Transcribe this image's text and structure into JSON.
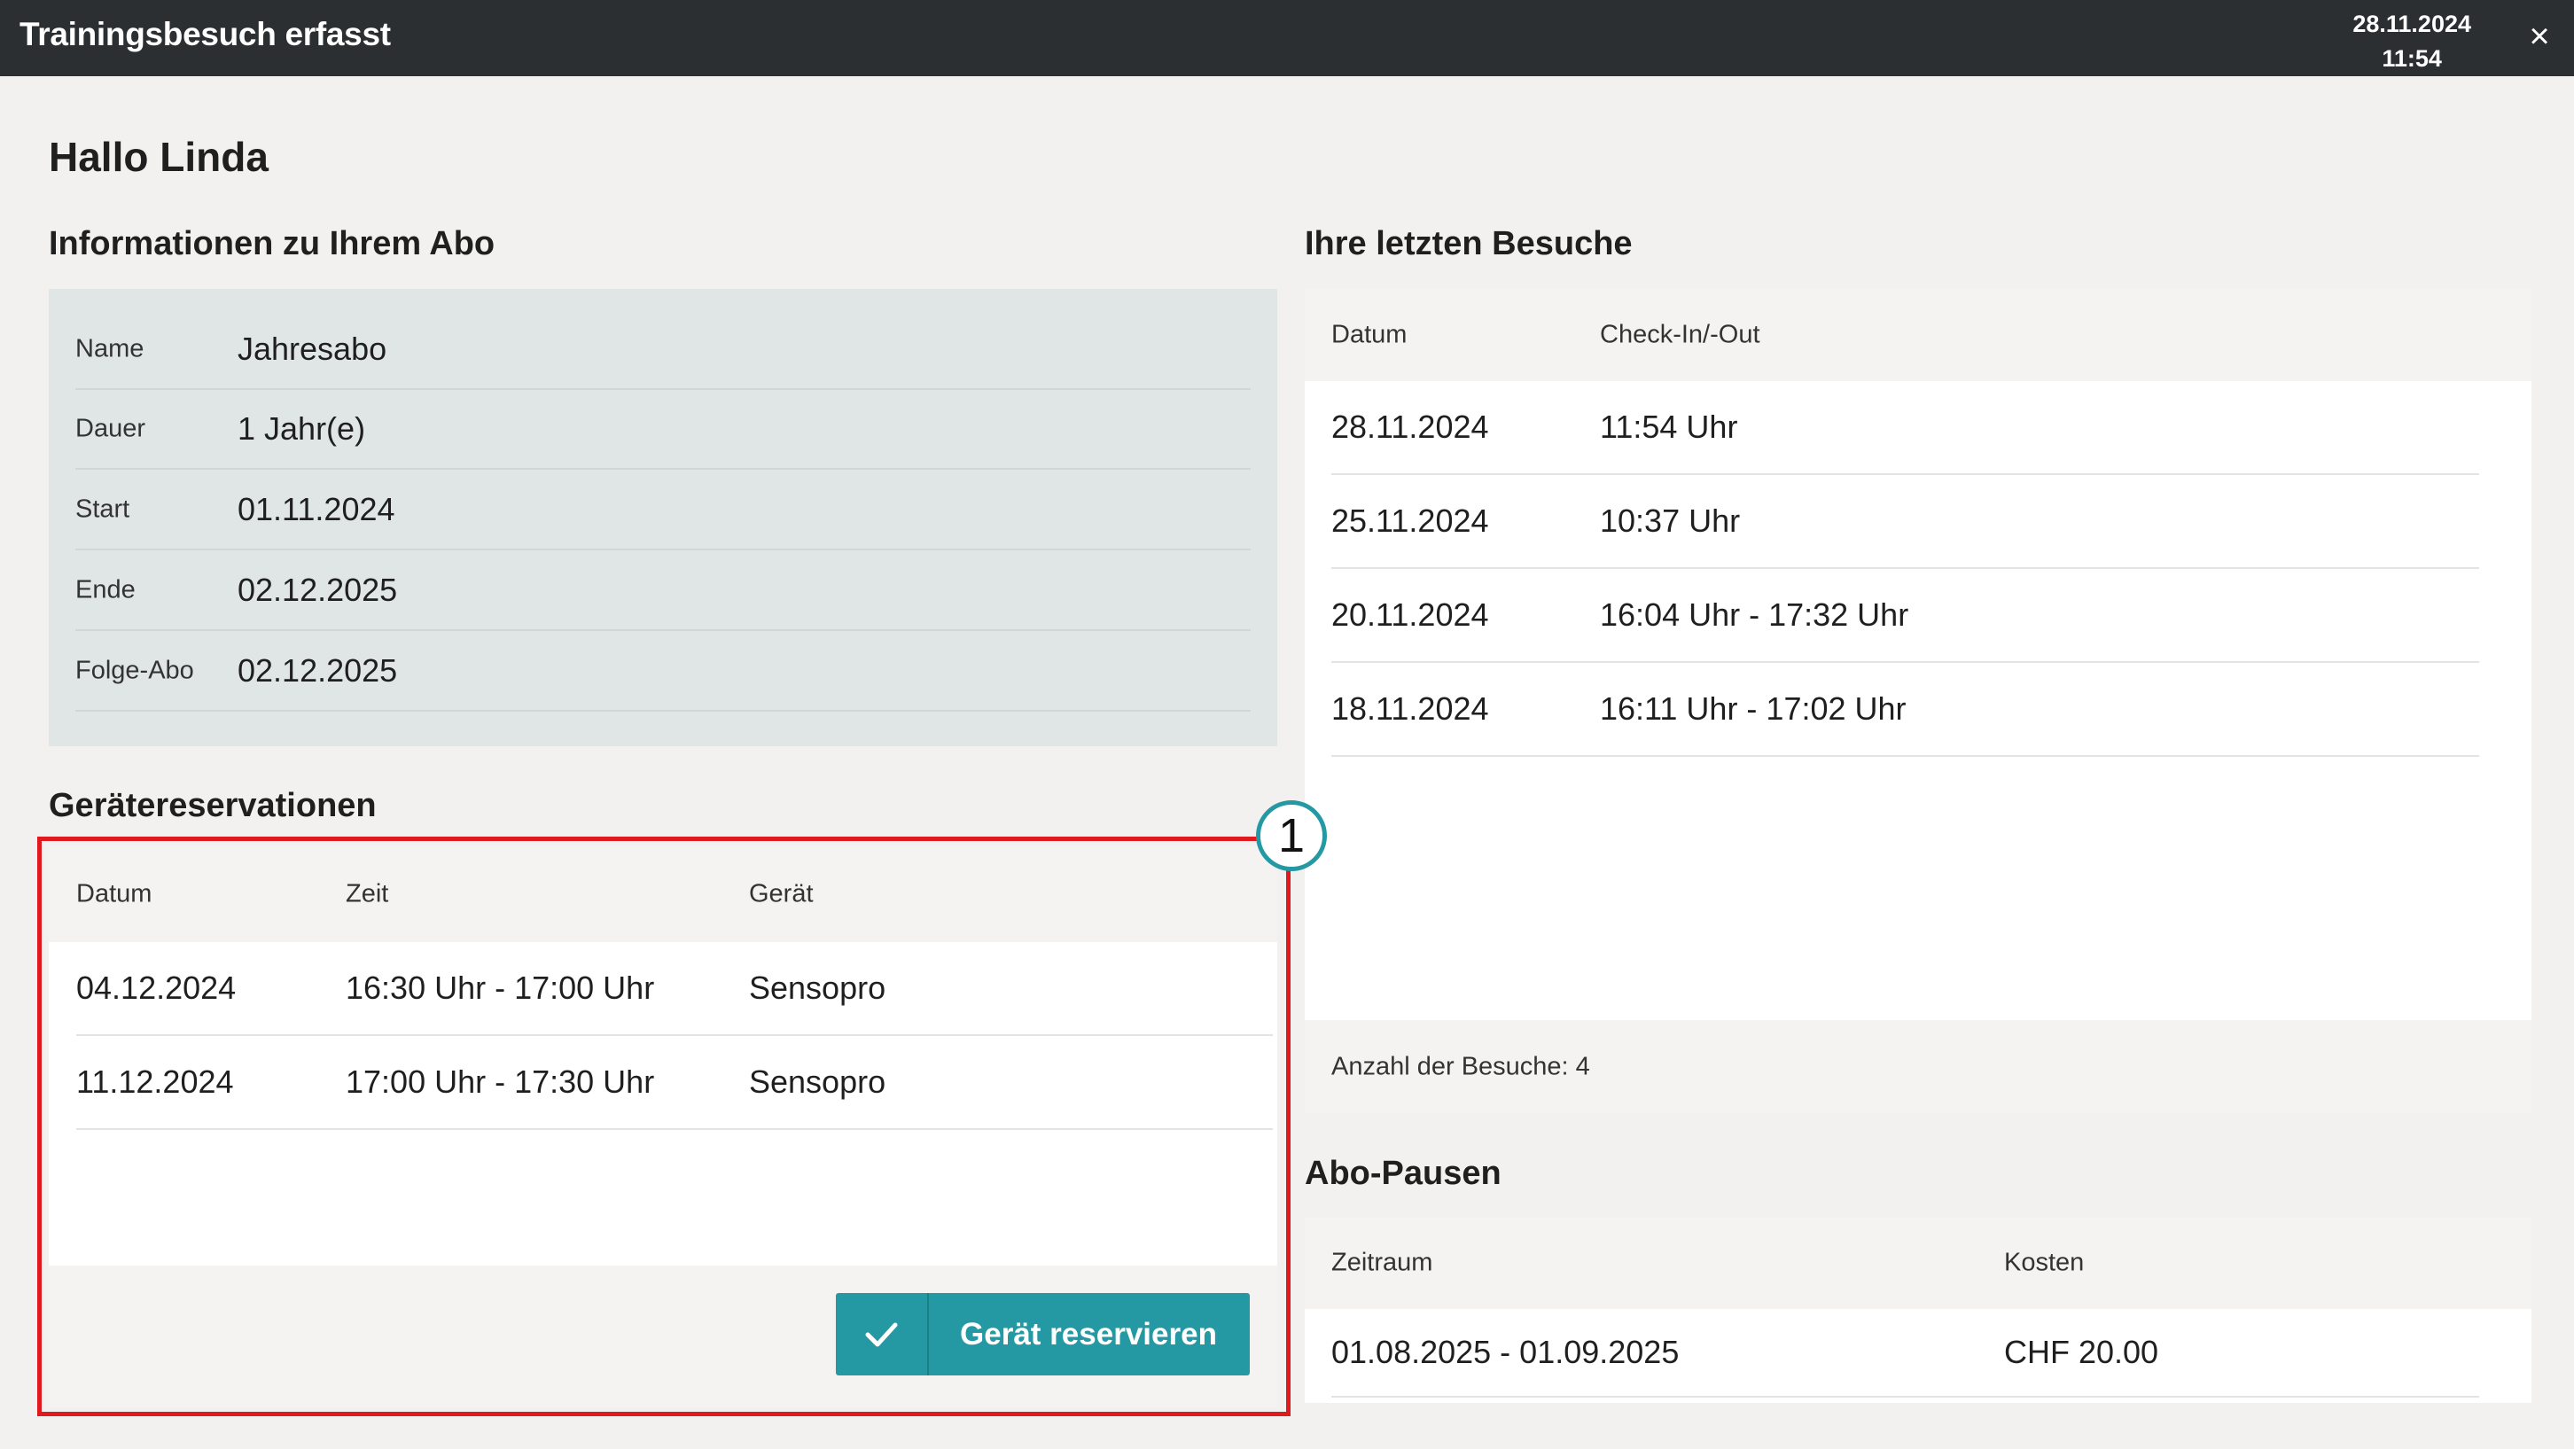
{
  "titlebar": {
    "title": "Trainingsbesuch erfasst",
    "date": "28.11.2024",
    "time": "11:54",
    "close_icon": "×"
  },
  "greeting": "Hallo Linda",
  "abo_info": {
    "title": "Informationen zu Ihrem Abo",
    "rows": [
      {
        "label": "Name",
        "value": "Jahresabo"
      },
      {
        "label": "Dauer",
        "value": "1 Jahr(e)"
      },
      {
        "label": "Start",
        "value": "01.11.2024"
      },
      {
        "label": "Ende",
        "value": "02.12.2025"
      },
      {
        "label": "Folge-Abo",
        "value": "02.12.2025"
      }
    ]
  },
  "reservations": {
    "title": "Gerätereservationen",
    "headers": [
      "Datum",
      "Zeit",
      "Gerät"
    ],
    "rows": [
      {
        "datum": "04.12.2024",
        "zeit": "16:30 Uhr - 17:00 Uhr",
        "geraet": "Sensopro"
      },
      {
        "datum": "11.12.2024",
        "zeit": "17:00 Uhr - 17:30 Uhr",
        "geraet": "Sensopro"
      }
    ],
    "button_label": "Gerät reservieren",
    "button_icon": "check-icon",
    "marker": "1"
  },
  "visits": {
    "title": "Ihre letzten Besuche",
    "headers": [
      "Datum",
      "Check-In/-Out"
    ],
    "rows": [
      {
        "datum": "28.11.2024",
        "check": "11:54 Uhr"
      },
      {
        "datum": "25.11.2024",
        "check": "10:37 Uhr"
      },
      {
        "datum": "20.11.2024",
        "check": "16:04 Uhr - 17:32 Uhr"
      },
      {
        "datum": "18.11.2024",
        "check": "16:11 Uhr - 17:02 Uhr"
      }
    ],
    "count_label": "Anzahl der Besuche: 4"
  },
  "pauses": {
    "title": "Abo-Pausen",
    "headers": [
      "Zeitraum",
      "Kosten"
    ],
    "rows": [
      {
        "zeitraum": "01.08.2025 - 01.09.2025",
        "kosten": "CHF 20.00"
      }
    ]
  },
  "colors": {
    "titlebar": "#2b2f32",
    "accent": "#2599a3",
    "highlight": "#e0191e",
    "info_box": "#e0e6e6"
  }
}
